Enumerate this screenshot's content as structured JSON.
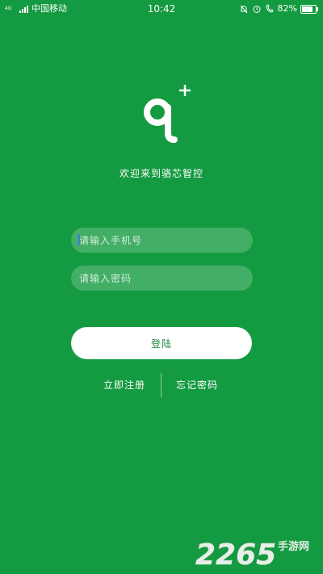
{
  "status_bar": {
    "carrier": "中国移动",
    "network": "4G",
    "time": "10:42",
    "battery": "82%",
    "battery_level": 0.82
  },
  "app": {
    "welcome": "欢迎来到骆芯智控"
  },
  "login_form": {
    "phone_placeholder": "请输入手机号",
    "password_placeholder": "请输入密码",
    "login_label": "登陆"
  },
  "links": {
    "register": "立即注册",
    "forgot_password": "忘记密码"
  },
  "watermark": {
    "number": "2265",
    "site": "手游网"
  },
  "colors": {
    "background": "#149a40",
    "button_text": "#1f8a44"
  }
}
